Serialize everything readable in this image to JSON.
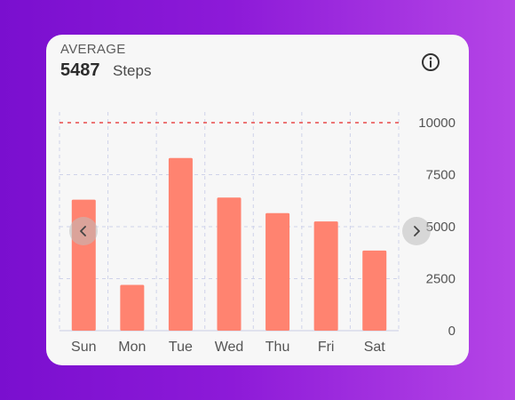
{
  "header": {
    "label": "AVERAGE",
    "value": "5487",
    "unit": "Steps"
  },
  "icons": {
    "info": "info-icon",
    "prev": "chevron-left-icon",
    "next": "chevron-right-icon"
  },
  "colors": {
    "bar": "#ff8370",
    "goal_line": "#e84a4a",
    "grid": "#cfd3ea",
    "background_start": "#7a0fcf",
    "background_end": "#b545e6"
  },
  "chart_data": {
    "type": "bar",
    "categories": [
      "Sun",
      "Mon",
      "Tue",
      "Wed",
      "Thu",
      "Fri",
      "Sat"
    ],
    "values": [
      6300,
      2200,
      8300,
      6400,
      5650,
      5250,
      3850
    ],
    "ylim": [
      0,
      10000
    ],
    "yticks": [
      0,
      2500,
      5000,
      7500,
      10000
    ],
    "goal_line": 10000,
    "grid": true,
    "y_axis_position": "right"
  }
}
